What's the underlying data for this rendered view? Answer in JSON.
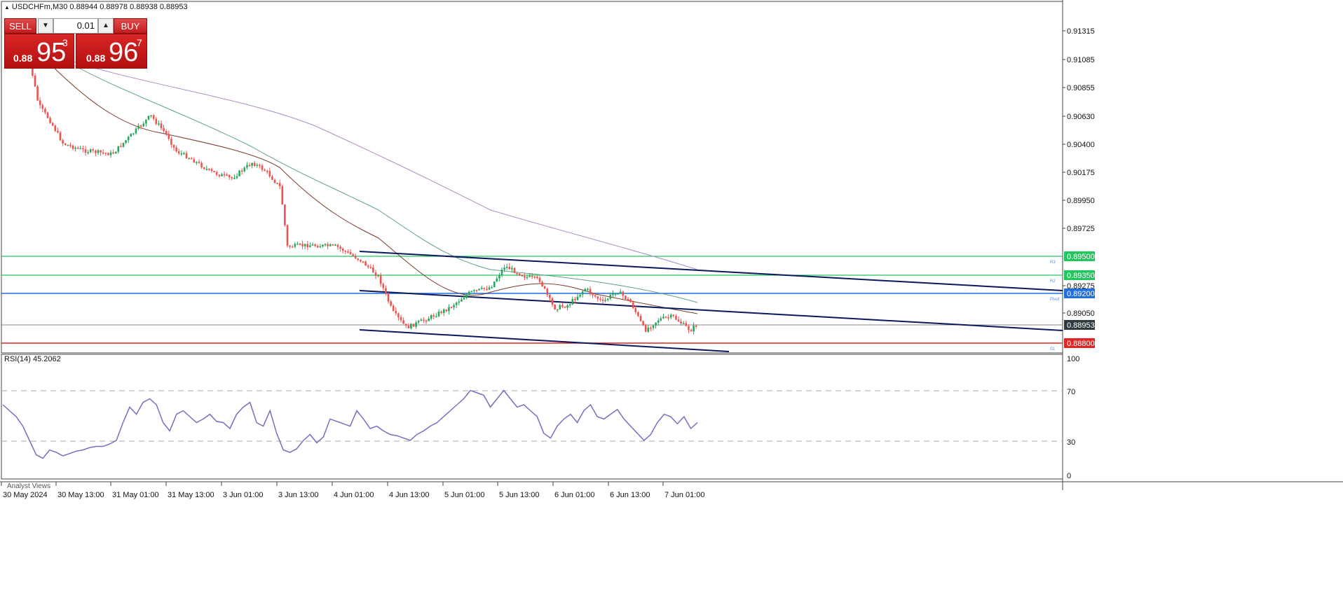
{
  "header": {
    "symbol_line": "USDCHFm,M30  0.88944 0.88978 0.88938 0.88953"
  },
  "trade_panel": {
    "sell_label": "SELL",
    "buy_label": "BUY",
    "lot_value": "0.01",
    "sell_price_small": "0.88",
    "sell_price_big": "95",
    "sell_price_sup": "3",
    "buy_price_small": "0.88",
    "buy_price_big": "96",
    "buy_price_sup": "7"
  },
  "price_axis": {
    "ticks": [
      "0.91315",
      "0.91085",
      "0.90855",
      "0.90630",
      "0.90400",
      "0.90175",
      "0.89950",
      "0.89725",
      "0.89275",
      "0.89050"
    ],
    "labels": [
      {
        "text": "0.89500",
        "bg": "#22c55e",
        "fg": "#ffffff"
      },
      {
        "text": "0.89350",
        "bg": "#22c55e",
        "fg": "#ffffff"
      },
      {
        "text": "0.89200",
        "bg": "#1f6fe0",
        "fg": "#ffffff"
      },
      {
        "text": "0.88953",
        "bg": "#2f3a40",
        "fg": "#ffffff"
      },
      {
        "text": "0.88800",
        "bg": "#e02525",
        "fg": "#ffffff"
      }
    ],
    "pivot_tags": [
      "R3",
      "R2",
      "Pivot",
      "S1"
    ]
  },
  "time_axis": {
    "labels": [
      "30 May 2024",
      "30 May 13:00",
      "31 May 01:00",
      "31 May 13:00",
      "3 Jun 01:00",
      "3 Jun 13:00",
      "4 Jun 01:00",
      "4 Jun 13:00",
      "5 Jun 01:00",
      "5 Jun 13:00",
      "6 Jun 01:00",
      "6 Jun 13:00",
      "7 Jun 01:00"
    ]
  },
  "rsi": {
    "title": "RSI(14) 45.2062",
    "axis_ticks": [
      "100",
      "70",
      "30",
      "0"
    ],
    "values": [
      60,
      55,
      50,
      42,
      30,
      18,
      15,
      22,
      20,
      17,
      19,
      21,
      22,
      24,
      25,
      25,
      27,
      30,
      45,
      58,
      52,
      62,
      65,
      60,
      45,
      38,
      52,
      55,
      50,
      45,
      48,
      52,
      46,
      45,
      40,
      52,
      58,
      62,
      45,
      42,
      55,
      36,
      22,
      20,
      23,
      30,
      35,
      28,
      33,
      48,
      46,
      44,
      42,
      55,
      48,
      40,
      42,
      38,
      35,
      34,
      32,
      30,
      35,
      38,
      42,
      45,
      50,
      55,
      60,
      65,
      72,
      70,
      68,
      58,
      65,
      72,
      65,
      58,
      60,
      55,
      50,
      36,
      32,
      42,
      48,
      52,
      45,
      55,
      60,
      50,
      48,
      52,
      56,
      48,
      42,
      36,
      30,
      35,
      45,
      52,
      50,
      44,
      50,
      40,
      45
    ]
  },
  "colors": {
    "bull_candle": "#26a65b",
    "bear_candle": "#ef5350",
    "rsi_line": "#7b6bbf",
    "trendline": "#0b1a5c"
  },
  "bottom_tab": {
    "label": "Analyst Views"
  }
}
